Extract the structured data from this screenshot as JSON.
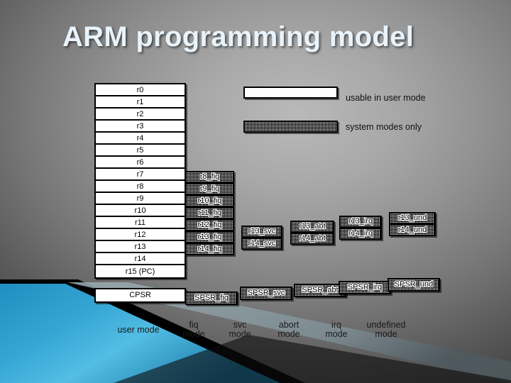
{
  "slide": {
    "title": "ARM programming model",
    "background_accent": "#2a93c4"
  },
  "legend": [
    {
      "label": "usable in user mode",
      "fill": "white"
    },
    {
      "label": "system modes only",
      "fill": "shaded"
    }
  ],
  "user_registers": [
    "r0",
    "r1",
    "r2",
    "r3",
    "r4",
    "r5",
    "r6",
    "r7",
    "r8",
    "r9",
    "r10",
    "r11",
    "r12",
    "r13",
    "r14",
    "r15 (PC)"
  ],
  "status_registers": {
    "user": "CPSR",
    "banked": [
      "SPSR_fiq",
      "SPSR_svc",
      "SPSR_abt",
      "SPSR_irq",
      "SPSR_und"
    ]
  },
  "banked_columns": [
    {
      "mode": "fiq",
      "registers": [
        "r8_fiq",
        "r9_fiq",
        "r10_fiq",
        "r11_fiq",
        "r12_fiq",
        "r13_fiq",
        "r14_fiq"
      ],
      "spsr": "SPSR_fiq"
    },
    {
      "mode": "svc",
      "registers": [
        "r13_svc",
        "r14_svc"
      ],
      "spsr": "SPSR_svc"
    },
    {
      "mode": "abort",
      "registers": [
        "r13_abt",
        "r14_abt"
      ],
      "spsr": "SPSR_abt"
    },
    {
      "mode": "irq",
      "registers": [
        "r13_irq",
        "r14_irq"
      ],
      "spsr": "SPSR_irq"
    },
    {
      "mode": "undefined",
      "registers": [
        "r13_und",
        "r14_und"
      ],
      "spsr": "SPSR_und"
    }
  ],
  "mode_captions": [
    "user mode",
    "fiq\nmode",
    "svc\nmode",
    "abort\nmode",
    "irq\nmode",
    "undefined\nmode"
  ]
}
